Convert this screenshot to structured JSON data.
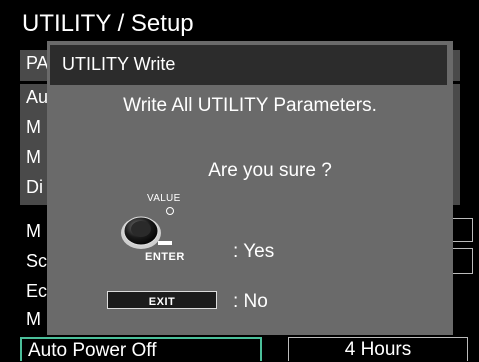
{
  "screen": {
    "title": "UTILITY / Setup",
    "rows": [
      {
        "label": "PA"
      },
      {
        "label": "Au"
      },
      {
        "label": "M"
      },
      {
        "label": "M"
      },
      {
        "label": "Di"
      },
      {
        "label": "M"
      },
      {
        "label": "Sc"
      },
      {
        "label": "Ec"
      },
      {
        "label": "M"
      }
    ],
    "auto_power_off": {
      "label": "Auto Power Off",
      "value": "4 Hours"
    }
  },
  "dialog": {
    "title": "UTILITY Write",
    "message": "Write All UTILITY Parameters.",
    "question": "Are you sure ?",
    "value_label": "VALUE",
    "enter_label": "ENTER",
    "yes_text": ": Yes",
    "exit_label": "EXIT",
    "no_text": ": No"
  },
  "colors": {
    "highlight_border": "#4bbf9a",
    "dialog_bg": "#6a6a6a",
    "dialog_title_bg": "#2c2c2c"
  }
}
